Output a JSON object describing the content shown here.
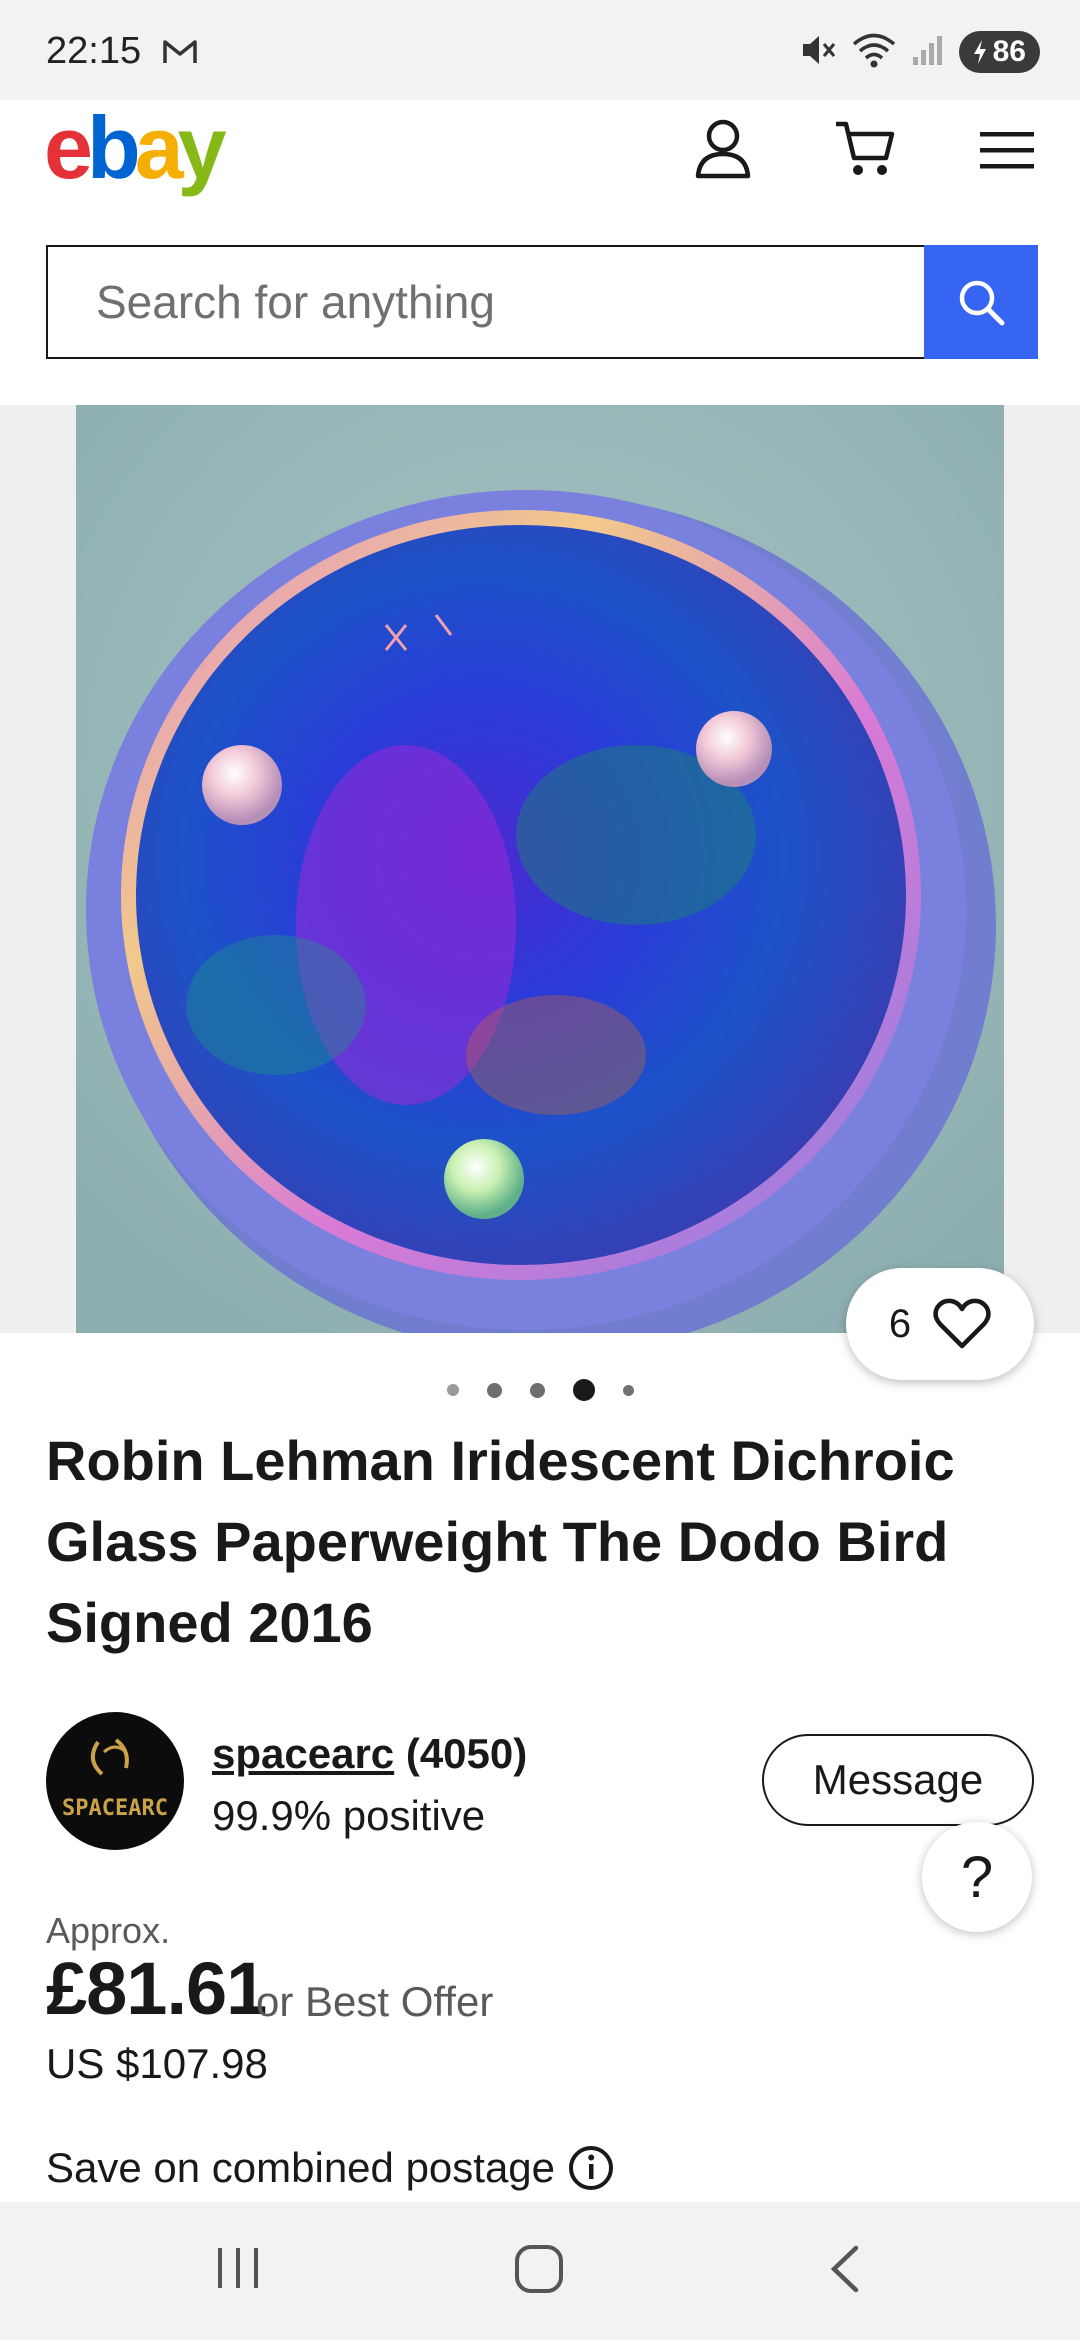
{
  "status_bar": {
    "time": "22:15",
    "battery": "86"
  },
  "header": {
    "logo": {
      "e": "e",
      "b": "b",
      "a": "a",
      "y": "y"
    },
    "brand_colors": {
      "red": "#e53238",
      "blue": "#0064d2",
      "yellow": "#f5af02",
      "green": "#86b817"
    },
    "accent": "#3665f3"
  },
  "search": {
    "placeholder": "Search for anything",
    "value": ""
  },
  "gallery": {
    "watch_count": "6",
    "image_count": 5,
    "active_index": 3
  },
  "listing": {
    "title": "Robin Lehman Iridescent Dichroic Glass Paperweight The Dodo Bird Signed 2016"
  },
  "seller": {
    "avatar_text": "SPACEARC",
    "name": "spacearc",
    "feedback_count": "(4050)",
    "feedback_percent": "99.9% positive",
    "message_label": "Message"
  },
  "help": {
    "label": "?"
  },
  "price": {
    "approx_label": "Approx.",
    "gbp": "£81.61",
    "best_offer": "or Best Offer",
    "usd": "US $107.98"
  },
  "postage": {
    "label": "Save on combined postage"
  }
}
